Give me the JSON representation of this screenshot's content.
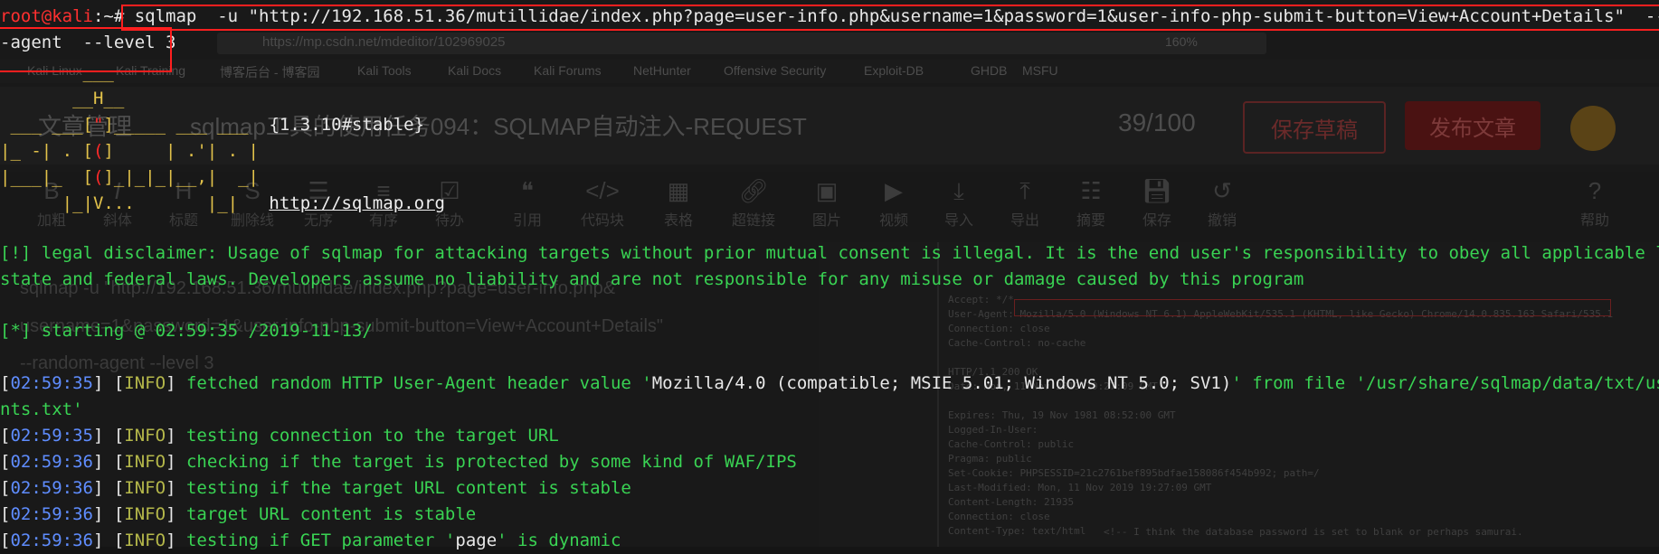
{
  "background": {
    "url": "https://mp.csdn.net/mdeditor/102969025",
    "zoom": "160%",
    "bookmarks": [
      "Kali Linux",
      "Kali Training",
      "博客后台 - 博客园",
      "Kali Tools",
      "Kali Docs",
      "Kali Forums",
      "NetHunter",
      "Offensive Security",
      "Exploit-DB",
      "GHDB",
      "MSFU"
    ],
    "editor_title": "文章管理",
    "article_title": "sqlmap工具的使用任务094：SQLMAP自动注入-REQUEST",
    "word_count": "39/100",
    "save_draft": "保存草稿",
    "publish": "发布文章",
    "toolbar": [
      {
        "icon": "bold-icon",
        "label": "加粗"
      },
      {
        "icon": "italic-icon",
        "label": "斜体"
      },
      {
        "icon": "heading-icon",
        "label": "标题"
      },
      {
        "icon": "strikethrough-icon",
        "label": "删除线"
      },
      {
        "icon": "unordered-list-icon",
        "label": "无序"
      },
      {
        "icon": "ordered-list-icon",
        "label": "有序"
      },
      {
        "icon": "todo-icon",
        "label": "待办"
      },
      {
        "icon": "quote-icon",
        "label": "引用"
      },
      {
        "icon": "code-icon",
        "label": "代码块"
      },
      {
        "icon": "table-icon",
        "label": "表格"
      },
      {
        "icon": "link-icon",
        "label": "超链接"
      },
      {
        "icon": "image-icon",
        "label": "图片"
      },
      {
        "icon": "video-icon",
        "label": "视频"
      },
      {
        "icon": "import-icon",
        "label": "导入"
      },
      {
        "icon": "export-icon",
        "label": "导出"
      },
      {
        "icon": "summary-icon",
        "label": "摘要"
      },
      {
        "icon": "save-icon",
        "label": "保存"
      },
      {
        "icon": "undo-icon",
        "label": "撤销"
      },
      {
        "icon": "help-icon",
        "label": "帮助"
      }
    ],
    "editor_line1": "sqlmap -u \"http://192.168.51.36/mutillidae/index.php?page=user-info.php&",
    "editor_line2": "username=1&password=1&user-info-php-submit-button=View+Account+Details\"",
    "editor_line3": "--random-agent --level 3",
    "http_header": "Accept: */*\nUser-Agent: Mozilla/5.0 (Windows NT 6.1) AppleWebKit/535.1 (KHTML, like Gecko) Chrome/14.0.835.163 Safari/535.1\nConnection: close\nCache-Control: no-cache\n\nHTTP/1.1 200 OK\nDate: Mon, 11 Nov 2019 19:27:09 GMT\n\nExpires: Thu, 19 Nov 1981 08:52:00 GMT\nLogged-In-User:\nCache-Control: public\nPragma: public\nSet-Cookie: PHPSESSID=21c2761bef895bdfae158086f454b992; path=/\nLast-Modified: Mon, 11 Nov 2019 19:27:09 GMT\nContent-Length: 21935\nConnection: close\nContent-Type: text/html",
    "html_comment": "<!-- I think the database password is set to blank or perhaps samurai."
  },
  "terminal": {
    "prompt_user": "root@kali",
    "prompt_sep": ":~#",
    "command": "sqlmap  -u \"http://192.168.51.36/mutillidae/index.php?page=user-info.php&username=1&password=1&user-info-php-submit-button=View+Account+Details\"  --random",
    "command_cont": "-agent  --level 3",
    "logo": {
      "l1": "        ___",
      "l2": "       __H__",
      "l3a": " ___ ___[",
      "l3b": "\"",
      "l3c": "]_____ ___ ___  ",
      "version": "{1.3.10#stable}",
      "l4a": "|_ -| . [",
      "l4b": "(",
      "l4c": "]     | .'| . |",
      "l5a": "|___|_  [",
      "l5b": "(",
      "l5c": "]_|_|_|__,|  _|",
      "l6": "      |_|V...       |_|   ",
      "site": "http://sqlmap.org"
    },
    "disclaimer1": "[!] legal disclaimer: Usage of sqlmap for attacking targets without prior mutual consent is illegal. It is the end user's responsibility to obey all applicable local,",
    "disclaimer2": "state and federal laws. Developers assume no liability and are not responsible for any misuse or damage caused by this program",
    "starting": "[*] starting @ 02:59:35 /2019-11-13/",
    "log": [
      {
        "time": "02:59:35",
        "level": "INFO",
        "msg_a": "fetched random HTTP User-Agent header value '",
        "value": "Mozilla/4.0 (compatible; MSIE 5.01; Windows NT 5.0; SV1)",
        "msg_b": "' from file '/usr/share/sqlmap/data/txt/user-age"
      },
      {
        "time": "02:59:35",
        "level": "INFO",
        "msg": "testing connection to the target URL"
      },
      {
        "time": "02:59:36",
        "level": "INFO",
        "msg": "checking if the target is protected by some kind of WAF/IPS"
      },
      {
        "time": "02:59:36",
        "level": "INFO",
        "msg": "testing if the target URL content is stable"
      },
      {
        "time": "02:59:36",
        "level": "INFO",
        "msg": "target URL content is stable"
      },
      {
        "time": "02:59:36",
        "level": "INFO",
        "msg_a": "testing if GET parameter '",
        "value": "page",
        "msg_b": "' is dynamic"
      }
    ],
    "wrap_cont": "nts.txt'"
  }
}
